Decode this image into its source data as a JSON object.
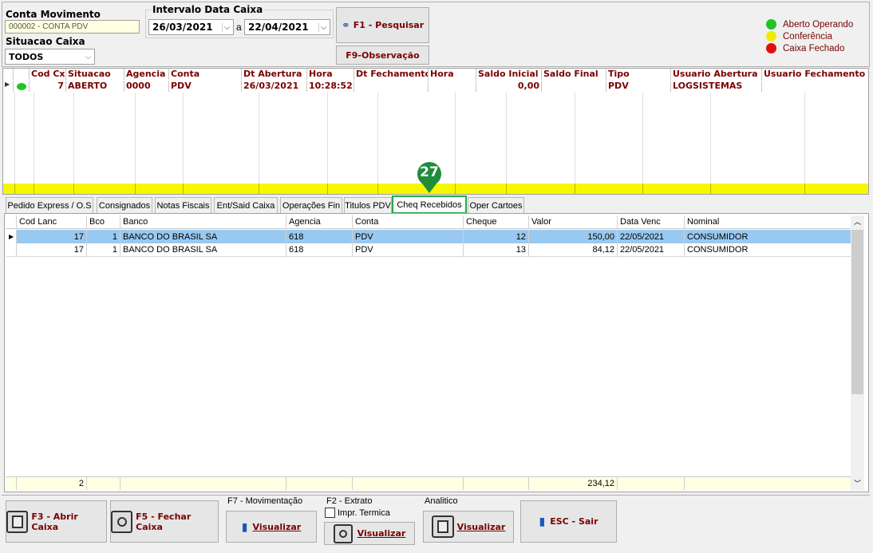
{
  "header": {
    "conta_movimento_label": "Conta Movimento",
    "conta_movimento_value": "000002 - CONTA PDV",
    "situacao_label": "Situacao Caixa",
    "situacao_value": "TODOS",
    "intervalo_label": "Intervalo Data Caixa",
    "date_from": "26/03/2021",
    "date_sep": "a",
    "date_to": "22/04/2021",
    "search_button": "F1 - Pesquisar",
    "obs_button": "F9-Observação"
  },
  "legend": [
    {
      "label": "Aberto Operando",
      "color": "#22c322"
    },
    {
      "label": "Conferência",
      "color": "#f2ea00"
    },
    {
      "label": "Caixa Fechado",
      "color": "#e01010"
    }
  ],
  "caixa_grid": {
    "headers": [
      "Cod Cx",
      "Situacao",
      "Agencia",
      "Conta",
      "Dt Abertura",
      "Hora",
      "Dt Fechamento",
      "Hora",
      "Saldo Inicial",
      "Saldo Final",
      "Tipo",
      "Usuario Abertura",
      "Usuario Fechamento"
    ],
    "rows": [
      {
        "status_color": "#22c322",
        "cod": "7",
        "situacao": "ABERTO",
        "agencia": "0000",
        "conta": "PDV",
        "dt_abertura": "26/03/2021",
        "hora": "10:28:52",
        "dt_fechamento": "",
        "hora2": "",
        "saldo_inicial": "0,00",
        "saldo_final": "",
        "tipo": "PDV",
        "usuario_abertura": "LOGSISTEMAS",
        "usuario_fechamento": ""
      }
    ]
  },
  "marker": "27",
  "tabs": [
    "Pedido Express / O.S",
    "Consignados",
    "Notas Fiscais",
    "Ent/Said Caixa",
    "Operações Fin",
    "Titulos PDV",
    "Cheq Recebidos",
    "Oper Cartoes"
  ],
  "active_tab": "Cheq Recebidos",
  "cheques": {
    "headers": [
      "Cod Lanc",
      "Bco",
      "Banco",
      "Agencia",
      "Conta",
      "Cheque",
      "Valor",
      "Data Venc",
      "Nominal"
    ],
    "rows": [
      {
        "cod": "17",
        "bco": "1",
        "banco": "BANCO DO BRASIL SA",
        "agencia": "618",
        "conta": "PDV",
        "cheque": "12",
        "valor": "150,00",
        "venc": "22/05/2021",
        "nominal": "CONSUMIDOR"
      },
      {
        "cod": "17",
        "bco": "1",
        "banco": "BANCO DO BRASIL SA",
        "agencia": "618",
        "conta": "PDV",
        "cheque": "13",
        "valor": "84,12",
        "venc": "22/05/2021",
        "nominal": "CONSUMIDOR"
      }
    ],
    "footer_count": "2",
    "footer_total": "234,12"
  },
  "bottom": {
    "abrir": "F3 - Abrir Caixa",
    "fechar": "F5 - Fechar Caixa",
    "mov_label": "F7 - Movimentação",
    "extrato_label": "F2 - Extrato",
    "impr_label": "Impr. Termica",
    "analitico_label": "Analitico",
    "visualizar": "Visualizar",
    "sair": "ESC - Sair"
  }
}
